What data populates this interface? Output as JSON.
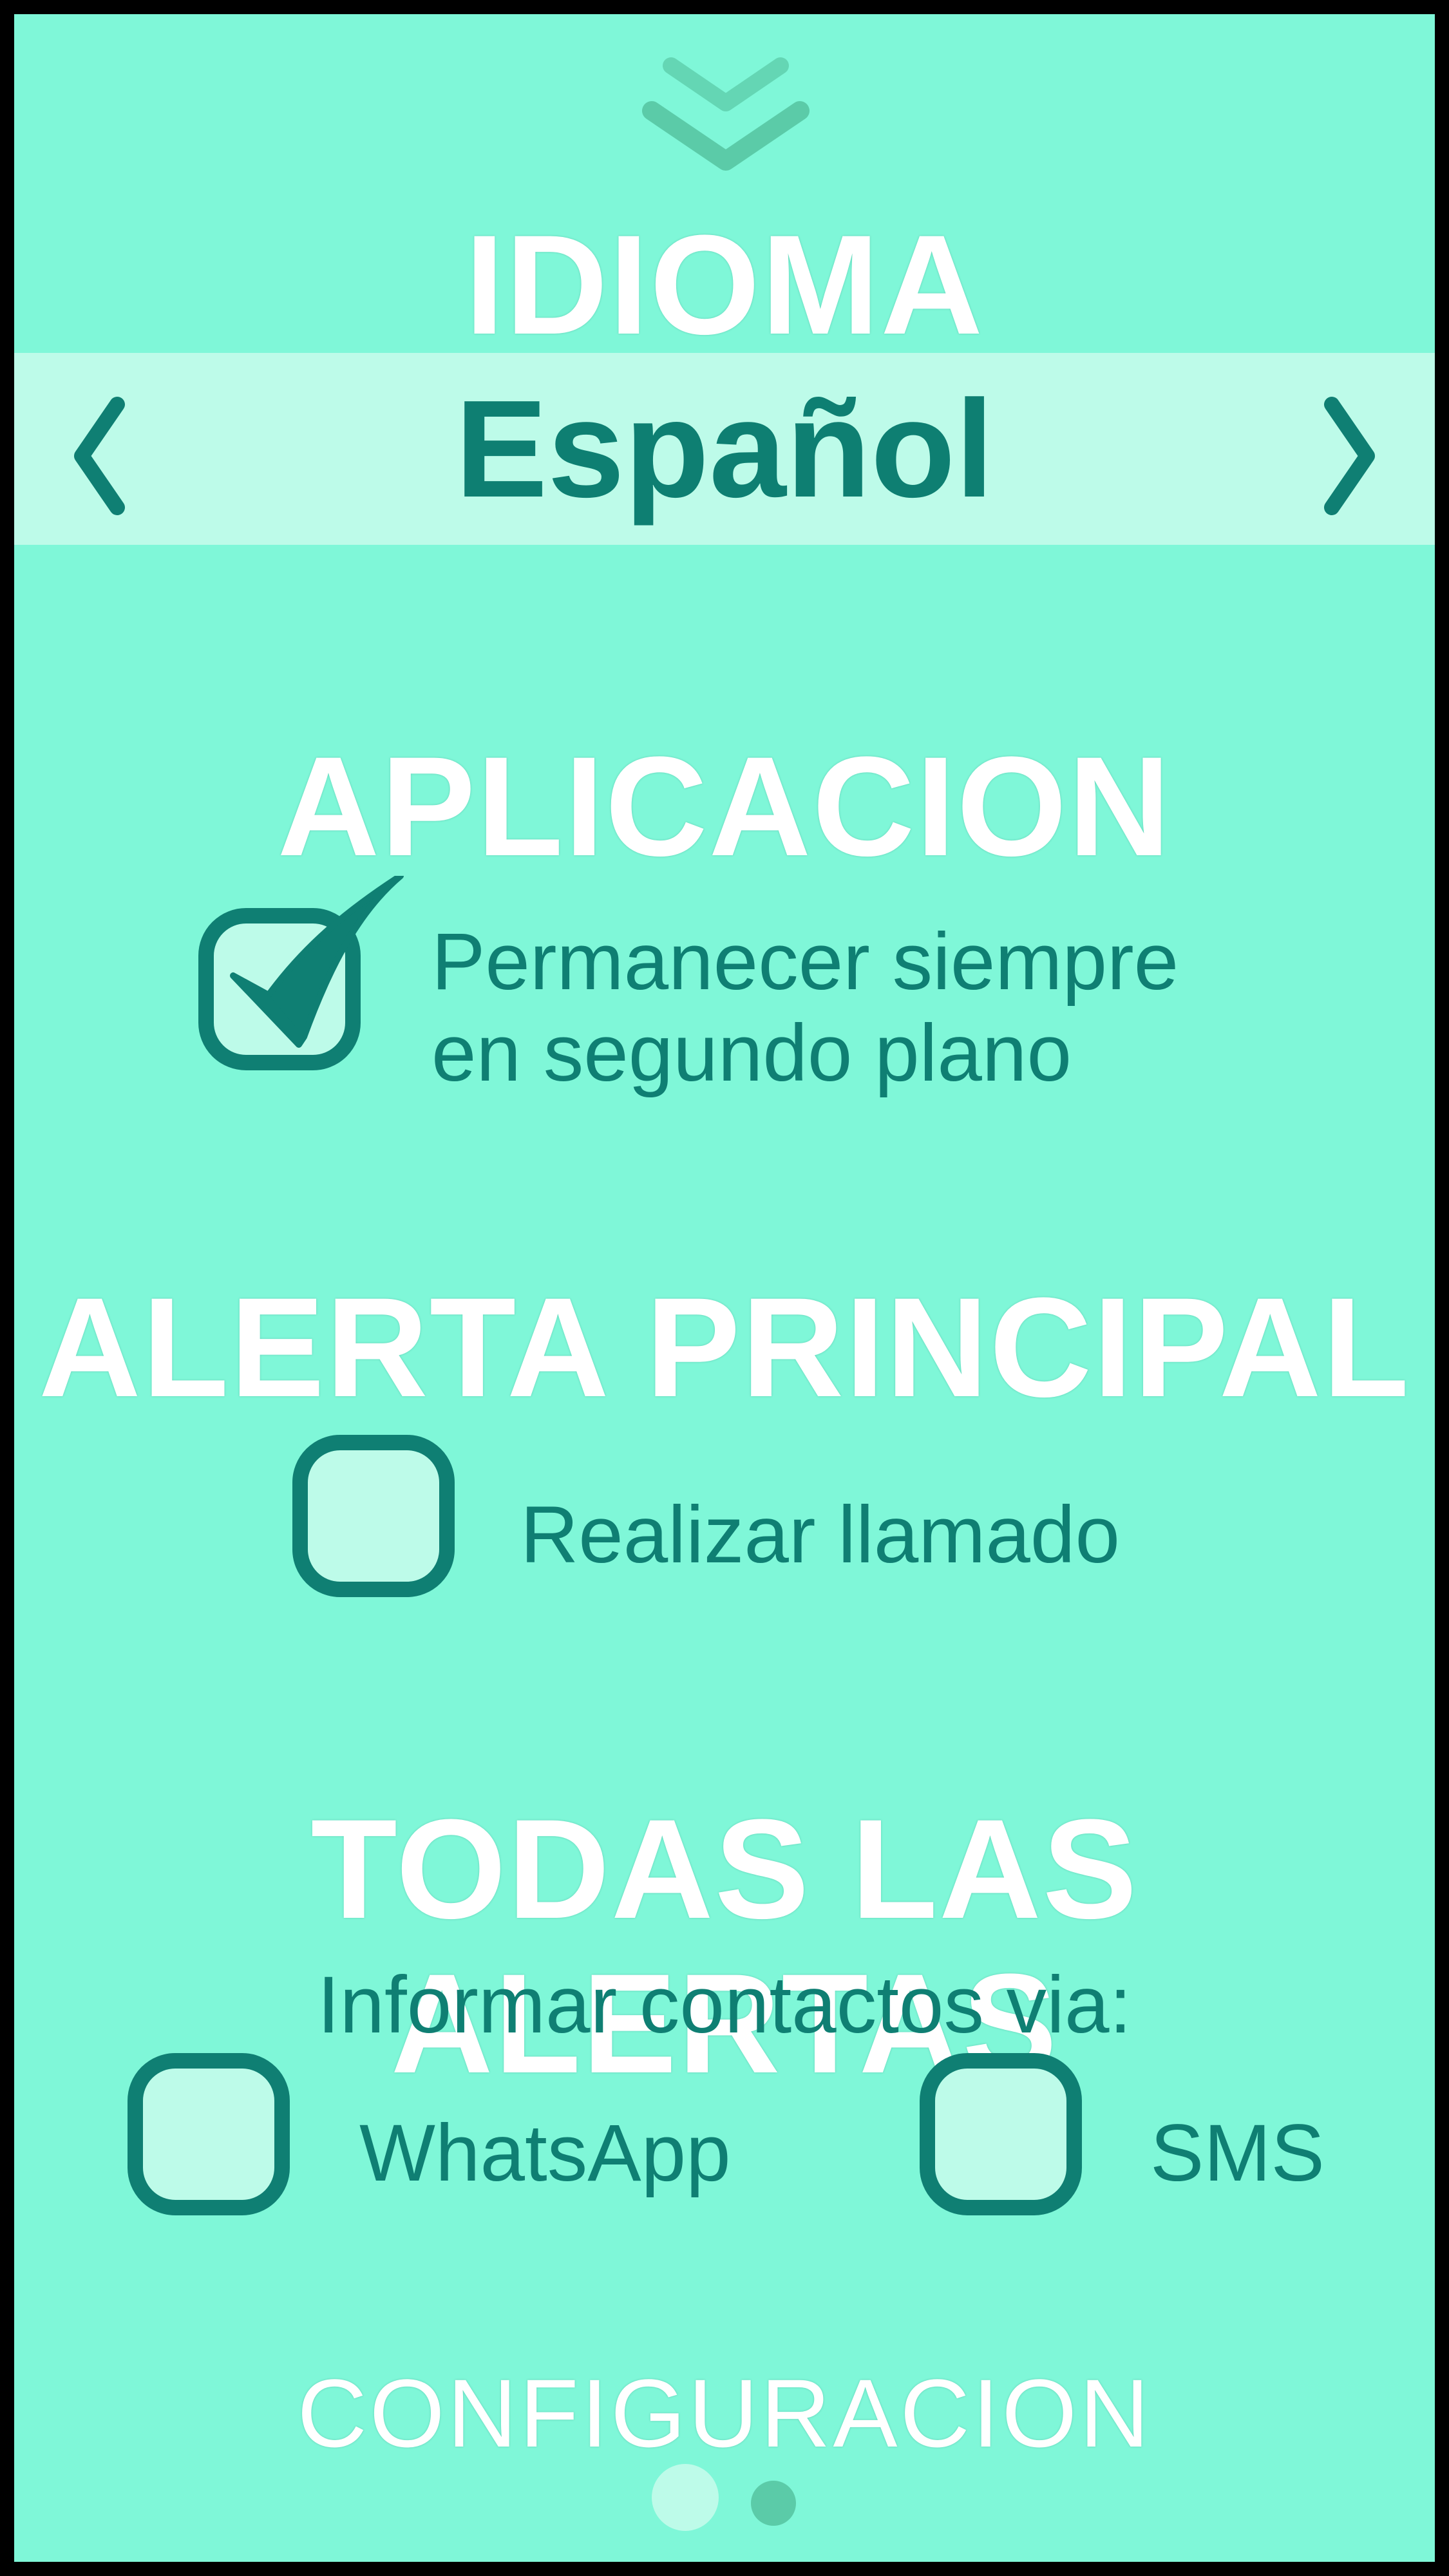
{
  "colors": {
    "background": "#7ff7d8",
    "band": "#bdfbe9",
    "accent": "#0f7f73",
    "title": "#ffffff",
    "chevron": "#5bcba8"
  },
  "icons": {
    "collapse": "double-chevron-down-icon",
    "previous": "chevron-left-icon",
    "next": "chevron-right-icon",
    "checked": "checkmark-icon"
  },
  "language": {
    "title": "IDIOMA",
    "selected": "Español"
  },
  "application": {
    "title": "APLICACION",
    "option_line1": "Permanecer siempre",
    "option_line2": "en segundo plano",
    "checked": true
  },
  "main_alert": {
    "title": "ALERTA PRINCIPAL",
    "option": "Realizar llamado",
    "checked": false
  },
  "all_alerts": {
    "title": "TODAS LAS ALERTAS",
    "subtitle": "Informar contactos via:",
    "options": [
      {
        "label": "WhatsApp",
        "checked": false
      },
      {
        "label": "SMS",
        "checked": false
      }
    ]
  },
  "footer": {
    "title": "CONFIGURACION",
    "page_indicator": {
      "pages": 2,
      "current": 1
    }
  }
}
